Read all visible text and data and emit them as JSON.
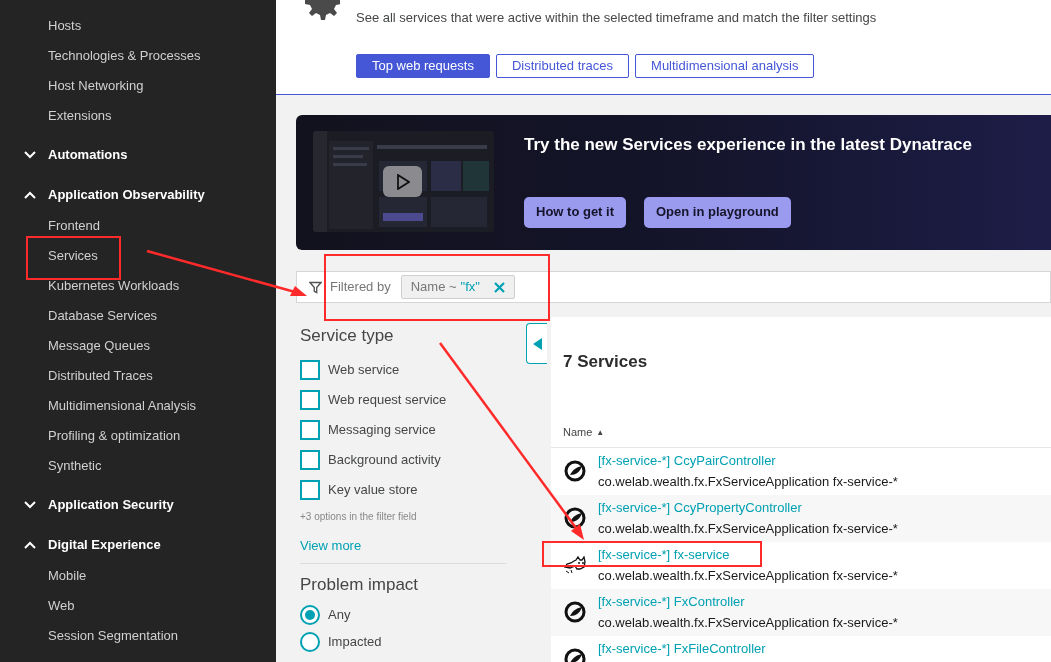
{
  "sidebar": {
    "items": [
      {
        "label": "Hosts"
      },
      {
        "label": "Technologies & Processes"
      },
      {
        "label": "Host Networking"
      },
      {
        "label": "Extensions"
      }
    ],
    "groups": [
      {
        "label": "Automations",
        "expanded": false
      },
      {
        "label": "Application Observability",
        "expanded": true,
        "children": [
          {
            "label": "Frontend"
          },
          {
            "label": "Services"
          },
          {
            "label": "Kubernetes Workloads"
          },
          {
            "label": "Database Services"
          },
          {
            "label": "Message Queues"
          },
          {
            "label": "Distributed Traces"
          },
          {
            "label": "Multidimensional Analysis"
          },
          {
            "label": "Profiling & optimization"
          },
          {
            "label": "Synthetic"
          }
        ]
      },
      {
        "label": "Application Security",
        "expanded": false
      },
      {
        "label": "Digital Experience",
        "expanded": true,
        "children": [
          {
            "label": "Mobile"
          },
          {
            "label": "Web"
          },
          {
            "label": "Session Segmentation"
          }
        ]
      }
    ]
  },
  "header": {
    "description": "See all services that were active within the selected timeframe and match the filter settings",
    "buttons": [
      {
        "label": "Top web requests",
        "kind": "primary"
      },
      {
        "label": "Distributed traces",
        "kind": "outline"
      },
      {
        "label": "Multidimensional analysis",
        "kind": "outline"
      }
    ]
  },
  "banner": {
    "title": "Try the new Services experience in the latest Dynatrace",
    "buttons": [
      "How to get it",
      "Open in playground"
    ]
  },
  "filter_bar": {
    "label": "Filtered by",
    "chips": [
      {
        "key": "Name ~",
        "value": "\"fx\""
      }
    ]
  },
  "filters": {
    "sections": [
      {
        "title": "Service type",
        "kind": "checkbox",
        "options": [
          {
            "label": "Web service",
            "checked": false
          },
          {
            "label": "Web request service",
            "checked": false
          },
          {
            "label": "Messaging service",
            "checked": false
          },
          {
            "label": "Background activity",
            "checked": false
          },
          {
            "label": "Key value store",
            "checked": false
          }
        ],
        "note": "+3 options in the filter field",
        "link": "View more"
      },
      {
        "title": "Problem impact",
        "kind": "radio",
        "options": [
          {
            "label": "Any",
            "selected": true
          },
          {
            "label": "Impacted",
            "selected": false
          }
        ]
      }
    ]
  },
  "services": {
    "title": "7 Services",
    "column": "Name",
    "sort": "▲",
    "rows": [
      {
        "kind": "spring",
        "name": "[fx-service-*] CcyPairController",
        "detail": "co.welab.wealth.fx.FxServiceApplication fx-service-*"
      },
      {
        "kind": "spring",
        "name": "[fx-service-*] CcyPropertyController",
        "detail": "co.welab.wealth.fx.FxServiceApplication fx-service-*"
      },
      {
        "kind": "tomcat",
        "name": "[fx-service-*] fx-service",
        "detail": "co.welab.wealth.fx.FxServiceApplication fx-service-*"
      },
      {
        "kind": "spring",
        "name": "[fx-service-*] FxController",
        "detail": "co.welab.wealth.fx.FxServiceApplication fx-service-*"
      },
      {
        "kind": "spring",
        "name": "[fx-service-*] FxFileController"
      }
    ]
  }
}
